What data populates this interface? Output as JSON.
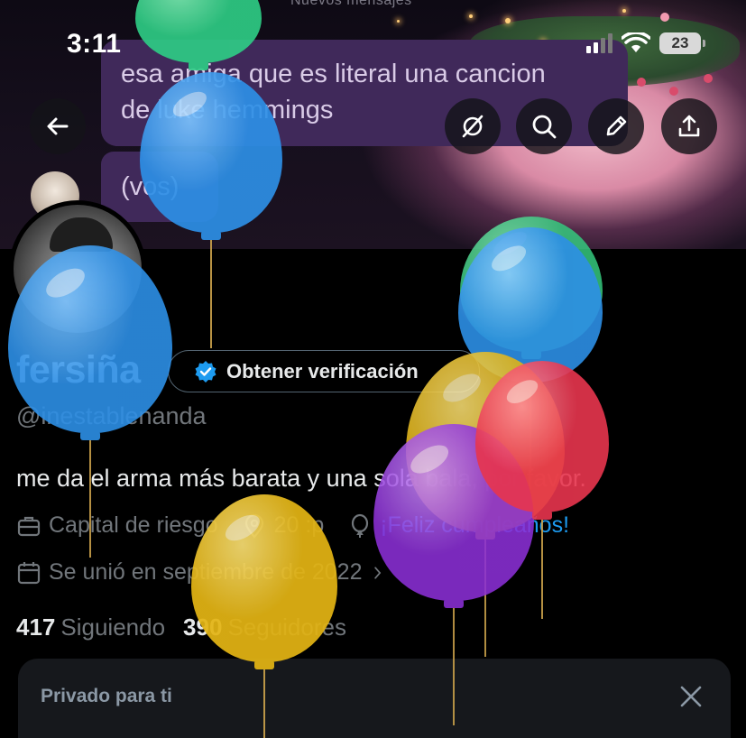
{
  "status_bar": {
    "time": "3:11",
    "battery": "23"
  },
  "banner": {
    "header_text": "Nuevos mensajes",
    "message_1_line1": "esa amiga que es literal una cancion",
    "message_1_line2": "de luke hemmings",
    "message_2": "(vos)"
  },
  "header_buttons": {
    "back": "arrow-left-icon",
    "grok": "grok-icon",
    "search": "search-icon",
    "edit": "pencil-icon",
    "share": "share-icon"
  },
  "profile": {
    "display_name": "fersiña",
    "verify_label": "Obtener verificación",
    "handle": "@inestablenanda",
    "bio": "me da el arma más barata y una sola bala, por favor.",
    "category": "Capital de riesgo",
    "location": "20 :p",
    "birthday": "¡Feliz cumpleaños!",
    "joined": "Se unió en septiembre de 2022",
    "following_count": "417",
    "following_label": "Siguiendo",
    "followers_count": "390",
    "followers_label": "Seguidores"
  },
  "private_card": {
    "title": "Privado para ti"
  },
  "colors": {
    "accent": "#1d9bf0",
    "muted": "#71767b",
    "bubble": "#40295a"
  }
}
